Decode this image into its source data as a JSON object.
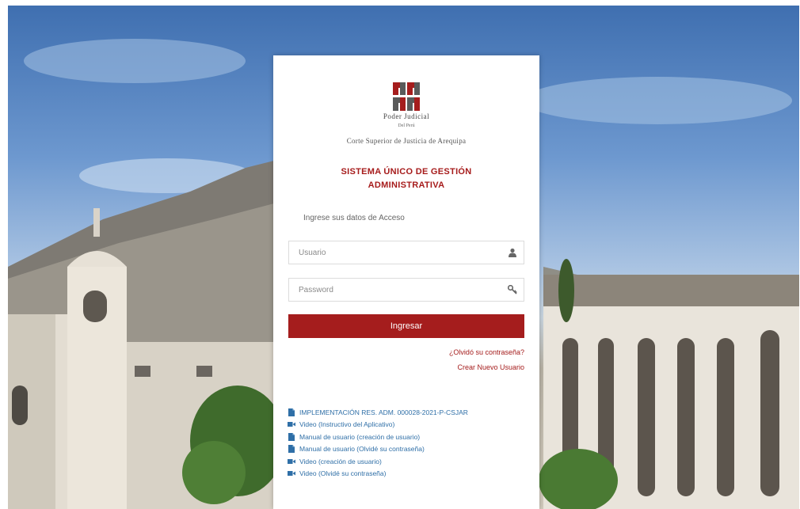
{
  "institution": {
    "name_line1": "Poder Judicial",
    "name_line2": "Del Perú",
    "court": "Corte Superior de Justicia de Arequipa"
  },
  "system_title": "SISTEMA ÚNICO DE GESTIÓN ADMINISTRATIVA",
  "login_prompt": "Ingrese sus datos de Acceso",
  "form": {
    "username_placeholder": "Usuario",
    "password_placeholder": "Password",
    "username_value": "",
    "password_value": "",
    "submit_label": "Ingresar",
    "username_icon": "user-icon",
    "password_icon": "key-icon"
  },
  "links": {
    "forgot_password": "¿Olvidó su contraseña?",
    "create_user": "Crear Nuevo Usuario"
  },
  "resources": [
    {
      "icon": "file-icon",
      "label": "IMPLEMENTACIÓN RES. ADM. 000028-2021-P-CSJAR"
    },
    {
      "icon": "video-icon",
      "label": "Video (Instructivo del Aplicativo)"
    },
    {
      "icon": "file-icon",
      "label": "Manual de usuario (creación de usuario)"
    },
    {
      "icon": "file-icon",
      "label": "Manual de usuario (Olvidé su contraseña)"
    },
    {
      "icon": "video-icon",
      "label": "Video (creación de usuario)"
    },
    {
      "icon": "video-icon",
      "label": "Video (Olvidé su contraseña)"
    }
  ],
  "colors": {
    "brand_red": "#a51d1d",
    "link_blue": "#2f6fa7",
    "logo_dark": "#5a5a5a"
  }
}
